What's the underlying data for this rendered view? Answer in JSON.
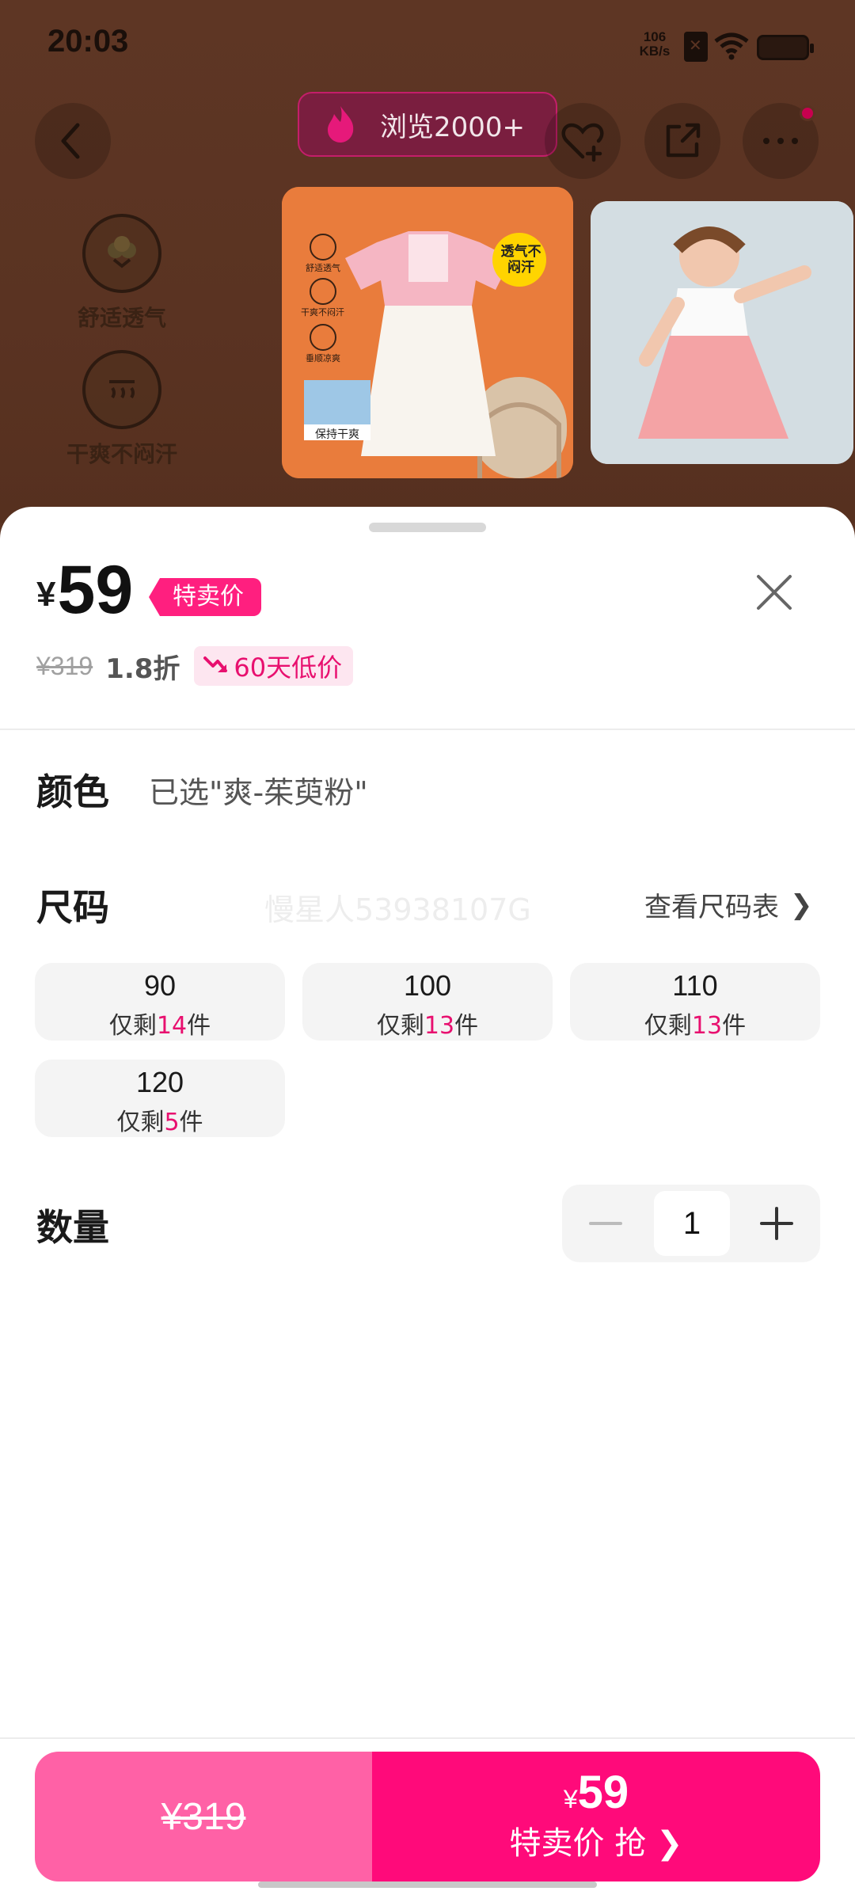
{
  "status_bar": {
    "time": "20:03",
    "net_speed_value": "106",
    "net_speed_unit": "KB/s"
  },
  "header": {
    "browse_count": "浏览2000+",
    "icons": [
      "back-icon",
      "fire-icon",
      "heart-add-icon",
      "share-icon",
      "more-icon"
    ]
  },
  "background_features": [
    {
      "label": "舒适透气",
      "icon": "cotton-icon"
    },
    {
      "label": "干爽不闷汗",
      "icon": "heat-icon"
    }
  ],
  "thumbnail_badges": {
    "main_bubble": "透气不闷汗",
    "main_side_labels": [
      "舒适透气",
      "干爽不闷汗",
      "垂顺凉爽"
    ],
    "main_bottom_label": "保持干爽"
  },
  "product": {
    "currency": "¥",
    "price": "59",
    "price_tag": "特卖价",
    "original_price": "¥319",
    "discount": "1.8折",
    "low_price_badge": "60天低价"
  },
  "color": {
    "label": "颜色",
    "selected": "已选\"爽-茱萸粉\""
  },
  "size": {
    "label": "尺码",
    "watermark": "慢星人53938107G",
    "chart_link": "查看尺码表",
    "options": [
      {
        "size": "90",
        "stock_prefix": "仅剩",
        "stock": "14",
        "stock_suffix": "件"
      },
      {
        "size": "100",
        "stock_prefix": "仅剩",
        "stock": "13",
        "stock_suffix": "件"
      },
      {
        "size": "110",
        "stock_prefix": "仅剩",
        "stock": "13",
        "stock_suffix": "件"
      },
      {
        "size": "120",
        "stock_prefix": "仅剩",
        "stock": "5",
        "stock_suffix": "件"
      }
    ]
  },
  "quantity": {
    "label": "数量",
    "value": "1"
  },
  "buy_bar": {
    "original_price": "¥319",
    "currency": "¥",
    "price": "59",
    "action_label": "特卖价 抢"
  },
  "colors": {
    "accent": "#ff0a7a",
    "accent_light": "#ff61a6",
    "badge_bg": "#fde6f0"
  }
}
